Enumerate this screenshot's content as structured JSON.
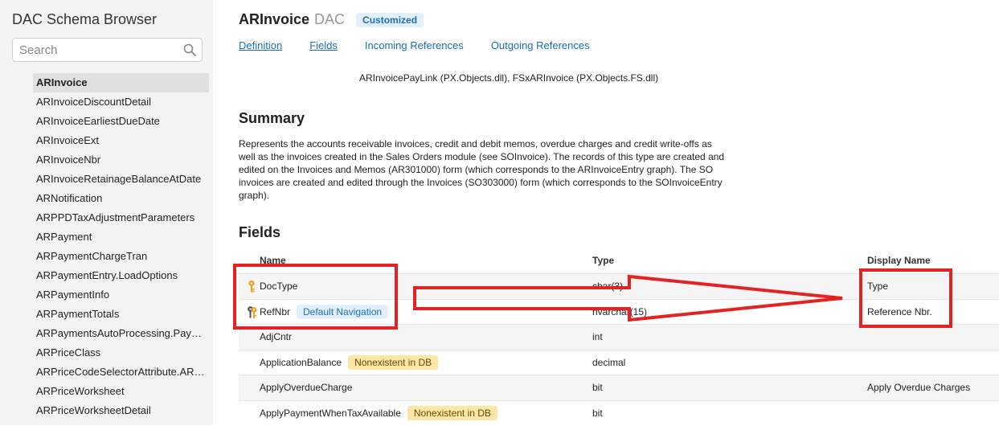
{
  "sidebar": {
    "title": "DAC Schema Browser",
    "search_placeholder": "Search",
    "items": [
      {
        "label": "ARInvoice",
        "active": true
      },
      {
        "label": "ARInvoiceDiscountDetail"
      },
      {
        "label": "ARInvoiceEarliestDueDate"
      },
      {
        "label": "ARInvoiceExt"
      },
      {
        "label": "ARInvoiceNbr"
      },
      {
        "label": "ARInvoiceRetainageBalanceAtDate"
      },
      {
        "label": "ARNotification"
      },
      {
        "label": "ARPPDTaxAdjustmentParameters"
      },
      {
        "label": "ARPayment"
      },
      {
        "label": "ARPaymentChargeTran"
      },
      {
        "label": "ARPaymentEntry.LoadOptions"
      },
      {
        "label": "ARPaymentInfo"
      },
      {
        "label": "ARPaymentTotals"
      },
      {
        "label": "ARPaymentsAutoProcessing.Pay…"
      },
      {
        "label": "ARPriceClass"
      },
      {
        "label": "ARPriceCodeSelectorAttribute.AR…"
      },
      {
        "label": "ARPriceWorksheet"
      },
      {
        "label": "ARPriceWorksheetDetail"
      }
    ]
  },
  "header": {
    "name": "ARInvoice",
    "type": "DAC",
    "badge": "Customized"
  },
  "tabs": [
    {
      "label": "Definition",
      "underlined": true
    },
    {
      "label": "Fields",
      "underlined": true
    },
    {
      "label": "Incoming References",
      "underlined": false
    },
    {
      "label": "Outgoing References",
      "underlined": false
    }
  ],
  "extensions_line": "ARInvoicePayLink (PX.Objects.dll),  FSxARInvoice (PX.Objects.FS.dll)",
  "summary": {
    "heading": "Summary",
    "text": "Represents the accounts receivable invoices, credit and debit memos, overdue charges and credit write-offs as well as the invoices created in the Sales Orders module (see SOInvoice). The records of this type are created and edited on the Invoices and Memos (AR301000) form (which corresponds to the ARInvoiceEntry graph). The SO invoices are created and edited through the Invoices (SO303000) form (which corresponds to the SOInvoiceEntry graph)."
  },
  "fields": {
    "heading": "Fields",
    "columns": {
      "name": "Name",
      "type": "Type",
      "display": "Display Name"
    },
    "rows": [
      {
        "name": "DocType",
        "type": "char(3)",
        "display": "Type",
        "key": "single",
        "tag": ""
      },
      {
        "name": "RefNbr",
        "type": "nvarchar(15)",
        "display": "Reference Nbr.",
        "key": "double",
        "tag": "Default Navigation",
        "tag_kind": "nav"
      },
      {
        "name": "AdjCntr",
        "type": "int",
        "display": "",
        "key": "",
        "tag": ""
      },
      {
        "name": "ApplicationBalance",
        "type": "decimal",
        "display": "",
        "key": "",
        "tag": "Nonexistent in DB",
        "tag_kind": "warn"
      },
      {
        "name": "ApplyOverdueCharge",
        "type": "bit",
        "display": "Apply Overdue Charges",
        "key": "",
        "tag": ""
      },
      {
        "name": "ApplyPaymentWhenTaxAvailable",
        "type": "bit",
        "display": "",
        "key": "",
        "tag": "Nonexistent in DB",
        "tag_kind": "warn"
      }
    ]
  },
  "colors": {
    "link": "#1a6fb5",
    "annotation": "#e32323",
    "key_icon": "#f0a020",
    "warn_tag_bg": "#fde6a6"
  }
}
